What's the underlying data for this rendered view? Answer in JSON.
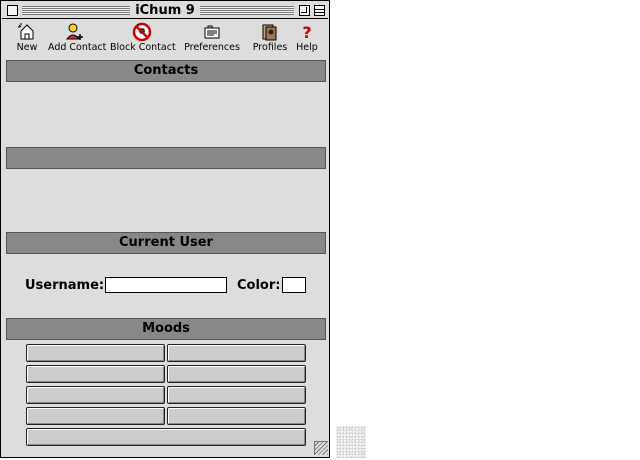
{
  "window": {
    "title": "iChum 9"
  },
  "toolbar": {
    "items": [
      {
        "label": "New",
        "icon": "new-document-icon"
      },
      {
        "label": "Add Contact",
        "icon": "add-contact-icon"
      },
      {
        "label": "Block Contact",
        "icon": "block-icon"
      },
      {
        "label": "Preferences",
        "icon": "preferences-icon"
      },
      {
        "label": "Profiles",
        "icon": "profiles-icon"
      },
      {
        "label": "Help",
        "icon": "help-icon"
      }
    ]
  },
  "sections": {
    "contacts": "Contacts",
    "second": "",
    "current_user": "Current User",
    "moods": "Moods"
  },
  "user": {
    "username_label": "Username:",
    "username_value": "",
    "color_label": "Color:",
    "color_value": "#ffffff"
  },
  "moods": {
    "buttons": [
      "",
      "",
      "",
      "",
      "",
      "",
      "",
      "",
      ""
    ]
  },
  "colors": {
    "window_bg": "#dddddd",
    "header_bg": "#888888",
    "help_red": "#cc0000"
  }
}
